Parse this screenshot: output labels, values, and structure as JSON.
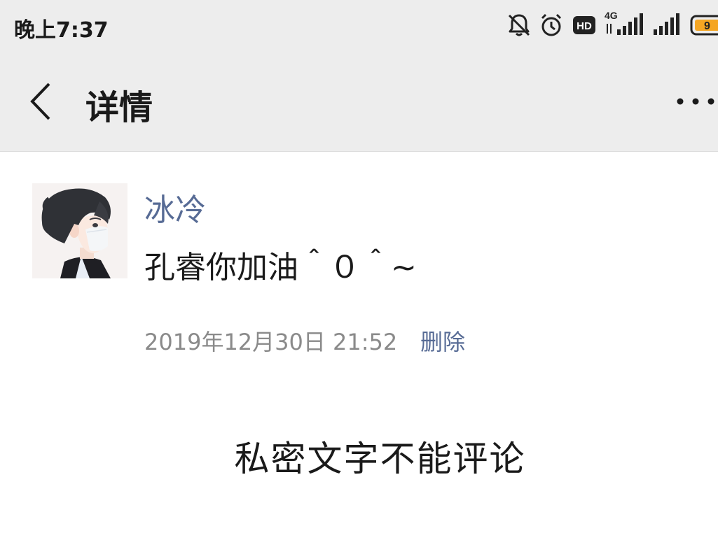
{
  "status_bar": {
    "time": "晚上7:37",
    "icons": [
      "bell-muted-icon",
      "alarm-icon",
      "hd-icon",
      "signal-4g-icon",
      "signal-icon",
      "battery-icon"
    ],
    "hd_label": "HD",
    "network_label": "4G"
  },
  "nav": {
    "back_icon": "chevron-left-icon",
    "title": "详情",
    "more_icon": "more-dots-icon"
  },
  "post": {
    "avatar": "avatar-illustration",
    "username": "冰冷",
    "text": "孔睿你加油＾０＾~",
    "timestamp": "2019年12月30日 21:52",
    "delete_label": "删除"
  },
  "notice": "私密文字不能评论",
  "colors": {
    "header_bg": "#ededed",
    "link": "#576b95",
    "text": "#1a1a1a",
    "muted": "#8a8a8a",
    "battery_accent": "#f5a623"
  }
}
